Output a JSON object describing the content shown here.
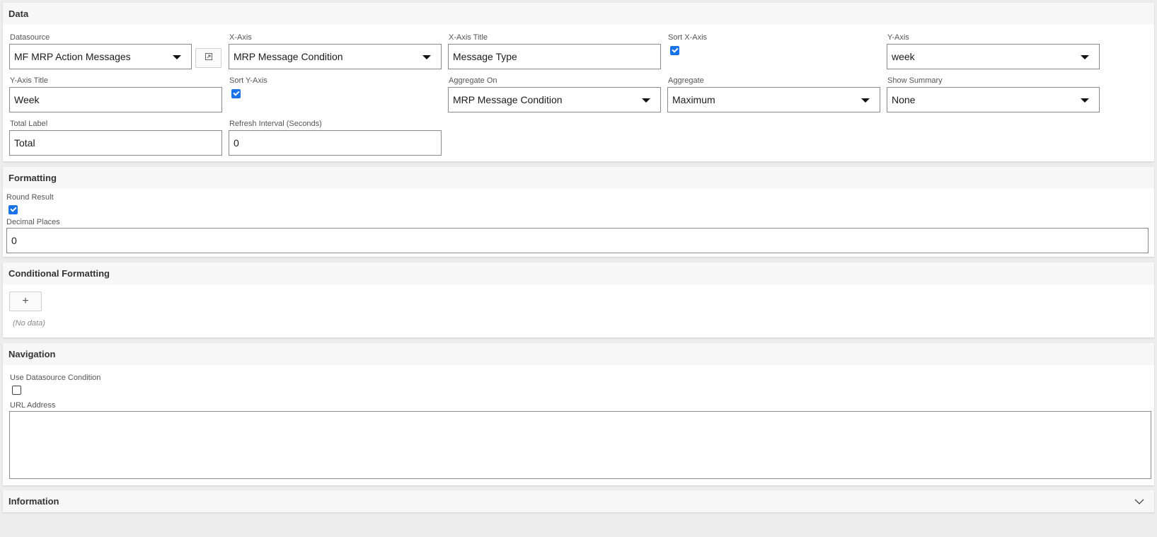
{
  "sections": {
    "data": {
      "title": "Data",
      "datasource": {
        "label": "Datasource",
        "value": "MF MRP Action Messages"
      },
      "x_axis": {
        "label": "X-Axis",
        "value": "MRP Message Condition"
      },
      "x_axis_title": {
        "label": "X-Axis Title",
        "value": "Message Type"
      },
      "sort_x_axis": {
        "label": "Sort X-Axis",
        "checked": true
      },
      "y_axis": {
        "label": "Y-Axis",
        "value": "week"
      },
      "y_axis_title": {
        "label": "Y-Axis Title",
        "value": "Week"
      },
      "sort_y_axis": {
        "label": "Sort Y-Axis",
        "checked": true
      },
      "aggregate_on": {
        "label": "Aggregate On",
        "value": "MRP Message Condition"
      },
      "aggregate": {
        "label": "Aggregate",
        "value": "Maximum"
      },
      "show_summary": {
        "label": "Show Summary",
        "value": "None"
      },
      "total_label": {
        "label": "Total Label",
        "value": "Total"
      },
      "refresh_interval": {
        "label": "Refresh Interval (Seconds)",
        "value": "0"
      }
    },
    "formatting": {
      "title": "Formatting",
      "round_result": {
        "label": "Round Result",
        "checked": true
      },
      "decimal_places": {
        "label": "Decimal Places",
        "value": "0"
      }
    },
    "conditional_formatting": {
      "title": "Conditional Formatting",
      "add_symbol": "+",
      "empty_text": "(No data)"
    },
    "navigation": {
      "title": "Navigation",
      "use_datasource_condition": {
        "label": "Use Datasource Condition",
        "checked": false
      },
      "url_address": {
        "label": "URL Address",
        "value": ""
      }
    },
    "information": {
      "title": "Information"
    }
  },
  "icons": {
    "datasource_link": "open-link-icon",
    "information_toggle": "chevron-down-icon"
  },
  "colors": {
    "checkbox_accent": "#1a73e8",
    "section_header_bg": "#f7f7f7",
    "page_bg": "#ececec"
  }
}
